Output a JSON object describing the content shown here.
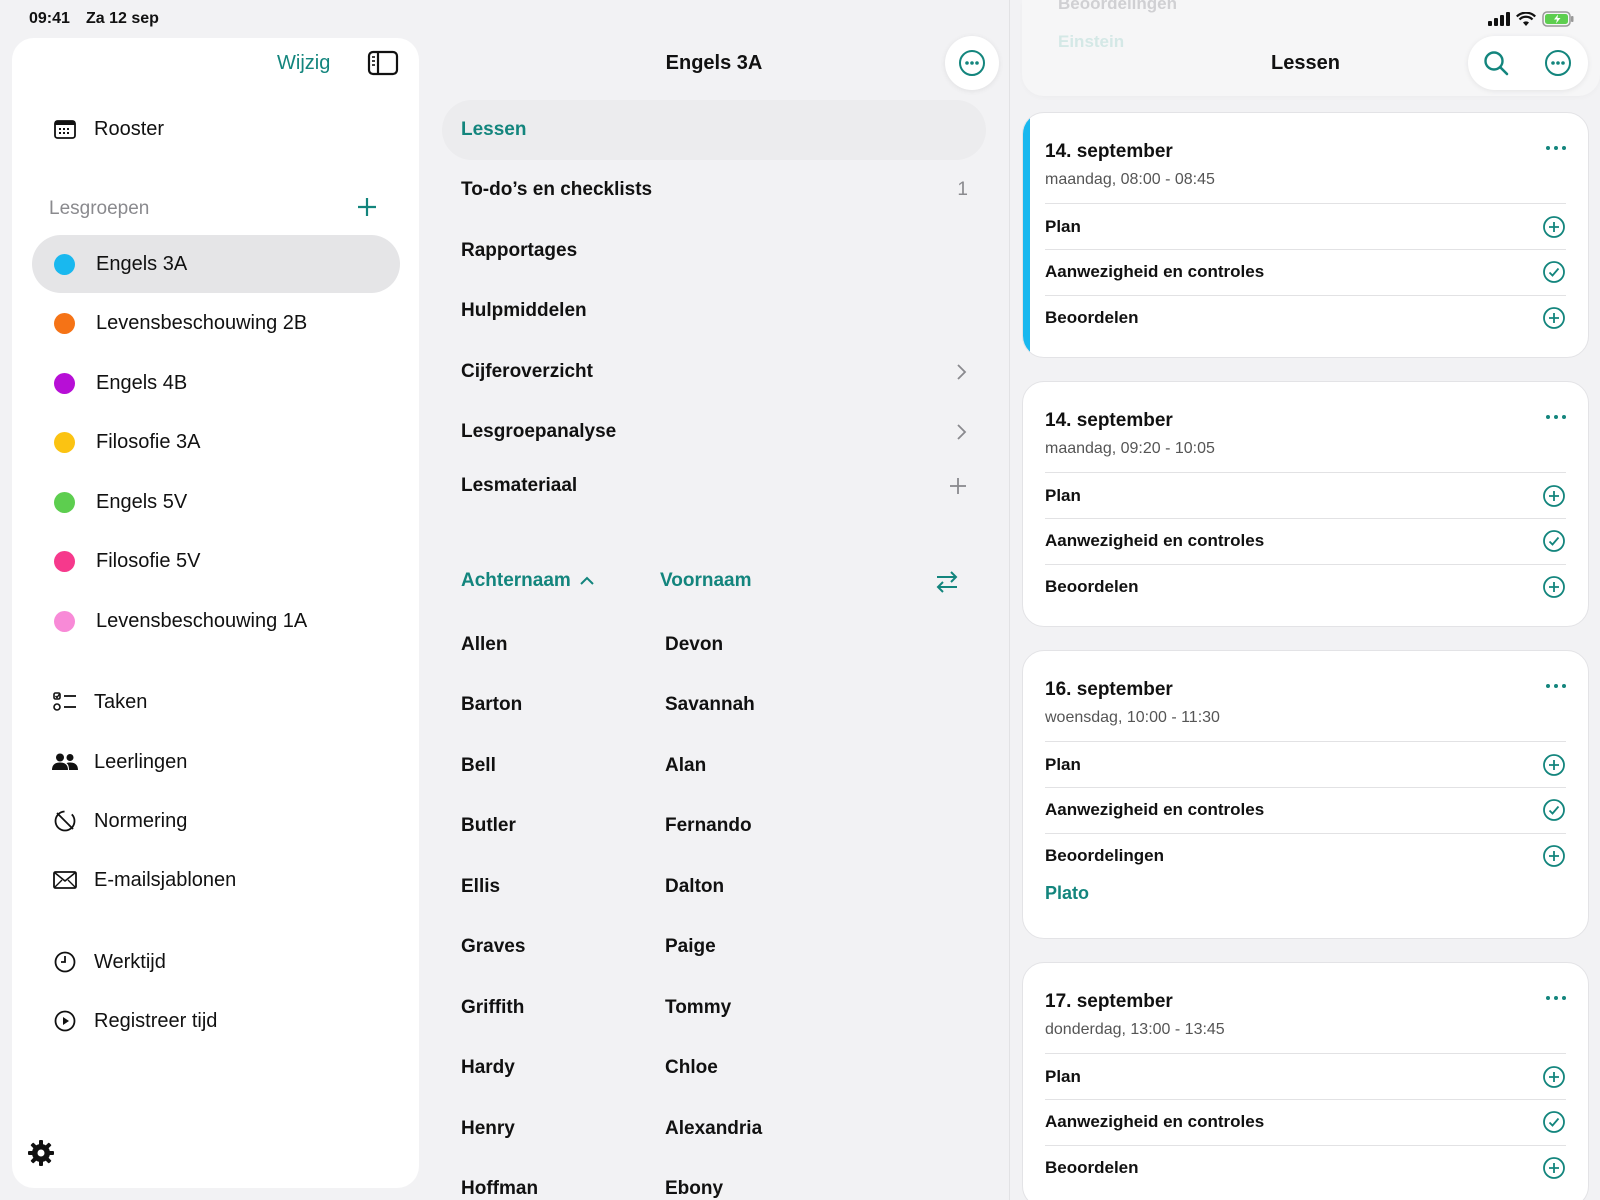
{
  "status": {
    "time": "09:41",
    "date": "Za 12 sep"
  },
  "sidebar": {
    "edit_label": "Wijzig",
    "schedule_label": "Rooster",
    "groups_title": "Lesgroepen",
    "groups": [
      {
        "label": "Engels 3A",
        "color": "#19b8ef"
      },
      {
        "label": "Levensbeschouwing 2B",
        "color": "#f57316"
      },
      {
        "label": "Engels 4B",
        "color": "#b70fd6"
      },
      {
        "label": "Filosofie 3A",
        "color": "#fbc312"
      },
      {
        "label": "Engels 5V",
        "color": "#5dce4f"
      },
      {
        "label": "Filosofie 5V",
        "color": "#f6398c"
      },
      {
        "label": "Levensbeschouwing 1A",
        "color": "#f88ad7"
      }
    ],
    "items": [
      {
        "label": "Taken"
      },
      {
        "label": "Leerlingen"
      },
      {
        "label": "Normering"
      },
      {
        "label": "E-mailsjablonen"
      },
      {
        "label": "Werktijd"
      },
      {
        "label": "Registreer tijd"
      }
    ]
  },
  "middle": {
    "title": "Engels 3A",
    "menu": [
      {
        "label": "Lessen"
      },
      {
        "label": "To-do’s en checklists",
        "badge": "1"
      },
      {
        "label": "Rapportages"
      },
      {
        "label": "Hulpmiddelen"
      },
      {
        "label": "Cijferoverzicht"
      },
      {
        "label": "Lesgroepanalyse"
      },
      {
        "label": "Lesmateriaal"
      }
    ],
    "sort_last": "Achternaam",
    "sort_first": "Voornaam",
    "students": [
      {
        "last": "Allen",
        "first": "Devon"
      },
      {
        "last": "Barton",
        "first": "Savannah"
      },
      {
        "last": "Bell",
        "first": "Alan"
      },
      {
        "last": "Butler",
        "first": "Fernando"
      },
      {
        "last": "Ellis",
        "first": "Dalton"
      },
      {
        "last": "Graves",
        "first": "Paige"
      },
      {
        "last": "Griffith",
        "first": "Tommy"
      },
      {
        "last": "Hardy",
        "first": "Chloe"
      },
      {
        "last": "Henry",
        "first": "Alexandria"
      },
      {
        "last": "Hoffman",
        "first": "Ebony"
      }
    ]
  },
  "right": {
    "title": "Lessen",
    "ghost_line1": "Beoordelingen",
    "ghost_line2": "Einstein",
    "lessons": [
      {
        "date": "14. september",
        "time": "maandag, 08:00 - 08:45",
        "rows": [
          "Plan",
          "Aanwezigheid en controles",
          "Beoordelen"
        ]
      },
      {
        "date": "14. september",
        "time": "maandag, 09:20 - 10:05",
        "rows": [
          "Plan",
          "Aanwezigheid en controles",
          "Beoordelen"
        ]
      },
      {
        "date": "16. september",
        "time": "woensdag, 10:00 - 11:30",
        "rows": [
          "Plan",
          "Aanwezigheid en controles",
          "Beoordelingen"
        ],
        "link": "Plato"
      },
      {
        "date": "17. september",
        "time": "donderdag, 13:00 - 13:45",
        "rows": [
          "Plan",
          "Aanwezigheid en controles",
          "Beoordelen"
        ]
      }
    ]
  },
  "colors": {
    "accent": "#13857d",
    "current_lesson": "#19b8ef"
  }
}
